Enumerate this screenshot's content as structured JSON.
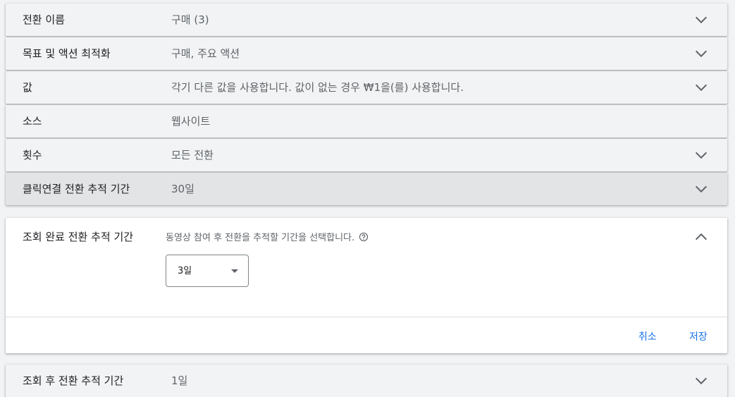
{
  "rows": [
    {
      "label": "전환 이름",
      "value": "구매 (3)",
      "has_chevron": true
    },
    {
      "label": "목표 및 액션 최적화",
      "value": "구매, 주요 액션",
      "has_chevron": true
    },
    {
      "label": "값",
      "value": "각기 다른 값을 사용합니다. 값이 없는 경우 ₩1을(를) 사용합니다.",
      "has_chevron": true
    },
    {
      "label": "소스",
      "value": "웹사이트",
      "has_chevron": false
    },
    {
      "label": "횟수",
      "value": "모든 전환",
      "has_chevron": true
    },
    {
      "label": "클릭연결 전환 추적 기간",
      "value": "30일",
      "has_chevron": true
    }
  ],
  "expanded": {
    "label": "조회 완료 전환 추적 기간",
    "description": "동영상 참여 후 전환을 추적할 기간을 선택합니다.",
    "select_value": "3일",
    "cancel_label": "취소",
    "save_label": "저장"
  },
  "partial_row": {
    "label": "조회 후 전환 추적 기간",
    "value": "1일"
  },
  "colors": {
    "accent": "#1a73e8",
    "background": "#f1f3f4",
    "hover_row": "#e3e4e6"
  }
}
